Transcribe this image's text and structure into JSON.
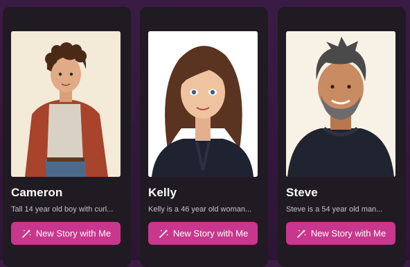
{
  "characters": [
    {
      "name": "Cameron",
      "description": "Tall 14 year old boy with curl...",
      "button_label": "New Story with Me",
      "icon": "magic-wand-icon"
    },
    {
      "name": "Kelly",
      "description": "Kelly is a 46 year old woman...",
      "button_label": "New Story with Me",
      "icon": "magic-wand-icon"
    },
    {
      "name": "Steve",
      "description": "Steve is a 54 year old man...",
      "button_label": "New Story with Me",
      "icon": "magic-wand-icon"
    }
  ],
  "colors": {
    "background": "#2f1738",
    "card": "#201a22",
    "button": "#c8378d",
    "text": "#ffffff",
    "muted_text": "#c9c2cc"
  }
}
